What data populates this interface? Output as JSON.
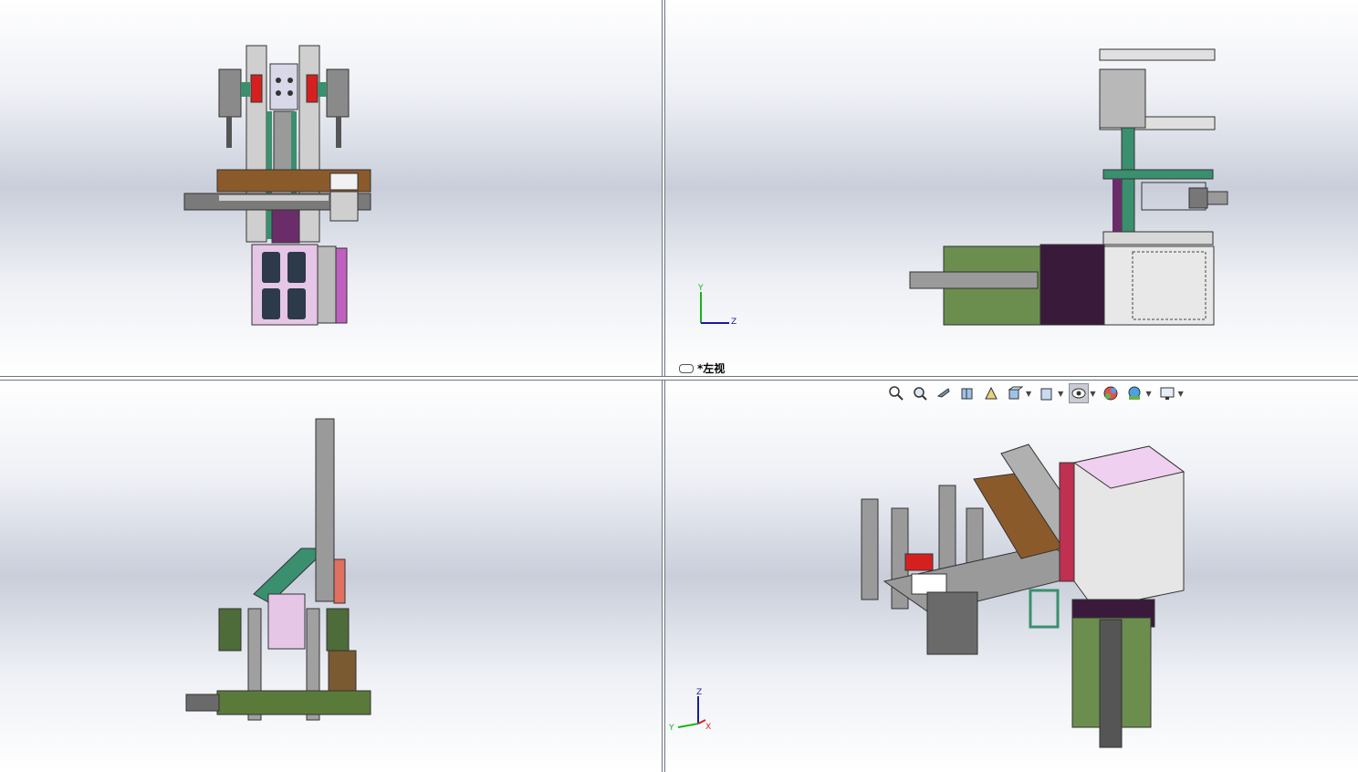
{
  "viewports": {
    "top_left": {
      "name": ""
    },
    "top_right": {
      "name": "*左视"
    },
    "bottom_left": {
      "name": ""
    },
    "bottom_right": {
      "name": ""
    }
  },
  "triads": {
    "left_view": {
      "up": "Y",
      "right": "Z"
    },
    "iso_view": {
      "up": "Z",
      "left": "Y",
      "right": "X"
    }
  },
  "toolbar": {
    "buttons": [
      {
        "icon": "zoom-to-fit-icon"
      },
      {
        "icon": "zoom-to-area-icon"
      },
      {
        "icon": "previous-view-icon"
      },
      {
        "icon": "section-view-icon"
      },
      {
        "icon": "dynamic-annotation-icon"
      },
      {
        "icon": "view-orientation-icon"
      },
      {
        "icon": "display-style-icon"
      },
      {
        "icon": "hide-show-items-icon"
      },
      {
        "icon": "edit-appearance-icon"
      },
      {
        "icon": "apply-scene-icon"
      },
      {
        "icon": "view-settings-icon"
      }
    ]
  },
  "colors": {
    "accent_green": "#5e8a55",
    "accent_teal": "#3a8f6e",
    "accent_purple": "#6a2d6a",
    "accent_brown": "#8b5a2b",
    "accent_red": "#d62020",
    "accent_pink": "#e6b8e6"
  }
}
